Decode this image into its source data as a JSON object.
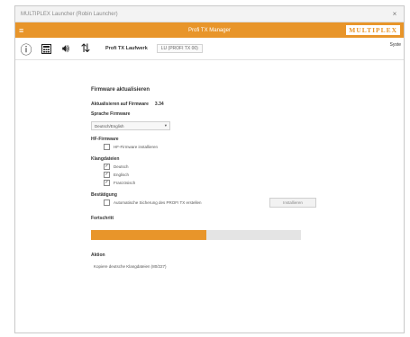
{
  "window": {
    "title": "MULTIPLEX Launcher (Robin Launcher)",
    "close": "×"
  },
  "app": {
    "title": "Profi TX Manager",
    "brand_logo": "MULTIPLEX",
    "accent": "#e8952a"
  },
  "toolbar": {
    "device": "Profi TX Laufwerk",
    "connection": "LU (PROFI TX 00)",
    "right_top": "",
    "right_bottom": "Syste"
  },
  "firmware": {
    "heading": "Firmware aktualisieren",
    "current_label": "Aktualisieren auf Firmware",
    "current_value": "3.34",
    "language_label": "Sprache Firmware",
    "language_value": "Deutsch/English",
    "hf_label": "HF-Firmware",
    "hf_option": "HF-Firmware installieren",
    "sounds_label": "Klangdateien",
    "sounds": [
      "Deutsch",
      "Englisch",
      "Französisch"
    ],
    "confirm_label": "Bestätigung",
    "confirm_option": "Automatische Sicherung des PROFI TX erstellen",
    "confirm_button": "Installieren",
    "progress_label": "Fortschritt",
    "progress": 0.55,
    "action_label": "Aktion",
    "action_value": "Kopiere deutsche Klangdateien (80/227)"
  }
}
